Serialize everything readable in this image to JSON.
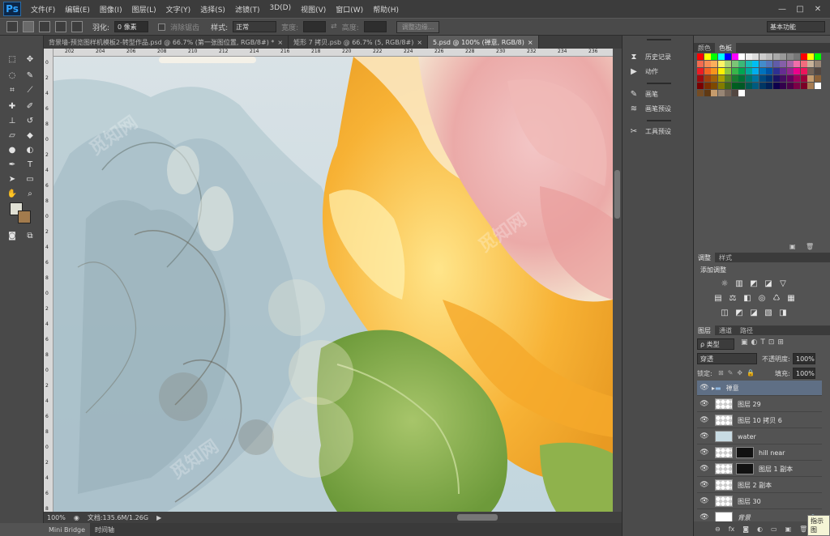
{
  "app": {
    "logo": "Ps"
  },
  "menu": [
    "文件(F)",
    "编辑(E)",
    "图像(I)",
    "图层(L)",
    "文字(Y)",
    "选择(S)",
    "滤镜(T)",
    "3D(D)",
    "视图(V)",
    "窗口(W)",
    "帮助(H)"
  ],
  "window_controls": {
    "minimize": "—",
    "restore": "□",
    "close": "✕"
  },
  "options_bar": {
    "feather_label": "羽化:",
    "feather_value": "0 像素",
    "antialias_label": "消除锯齿",
    "style_label": "样式:",
    "style_value": "正常",
    "width_label": "宽度:",
    "height_label": "高度:",
    "refine_button": "调整边缘...",
    "workspace": "基本功能"
  },
  "doc_tabs": [
    "背景墙-预览图样机模板2-转型作品.psd @ 66.7% (第一张图位置, RGB/8#) *",
    "矩形 7 拷贝.psb @ 66.7% (5, RGB/8#)",
    "5.psd @ 100% (禅意, RGB/8)"
  ],
  "ruler_top_labels": [
    "202",
    "204",
    "206",
    "208",
    "210",
    "212",
    "214",
    "216",
    "218",
    "220",
    "222",
    "224",
    "226",
    "228",
    "230",
    "232",
    "234",
    "236"
  ],
  "ruler_left_labels": [
    "0",
    "2",
    "4",
    "6",
    "8",
    "0",
    "2",
    "4",
    "6",
    "8",
    "0",
    "2",
    "4",
    "6",
    "8",
    "0",
    "2",
    "4",
    "6",
    "8",
    "0",
    "2",
    "4",
    "6",
    "8",
    "0",
    "2",
    "4",
    "6",
    "8"
  ],
  "status": {
    "zoom": "100%",
    "doc_info": "文档:135.6M/1.26G"
  },
  "bottom_tabs": [
    "Mini Bridge",
    "时间轴"
  ],
  "mid_panel": {
    "items": [
      {
        "label": "历史记录",
        "icon": "history-icon"
      },
      {
        "label": "动作",
        "icon": "play-icon"
      },
      {
        "label": "画笔",
        "icon": "brush-icon"
      },
      {
        "label": "画笔预设",
        "icon": "brush-preset-icon"
      },
      {
        "label": "工具预设",
        "icon": "tool-preset-icon"
      }
    ]
  },
  "swatch_panel": {
    "tabs": [
      "颜色",
      "色板"
    ]
  },
  "adjust_panel": {
    "tabs": [
      "调整",
      "样式"
    ],
    "title": "添加调整"
  },
  "layers_panel": {
    "tabs": [
      "图层",
      "通道",
      "路径"
    ],
    "filter_kind": "ρ 类型",
    "blend_mode": "穿透",
    "opacity_label": "不透明度:",
    "opacity_value": "100%",
    "lock_label": "锁定:",
    "fill_label": "填充:",
    "fill_value": "100%",
    "layers": [
      {
        "name": "禅意",
        "type": "group"
      },
      {
        "name": "图层 29",
        "type": "layer"
      },
      {
        "name": "图层 10 拷贝 6",
        "type": "layer"
      },
      {
        "name": "water",
        "type": "layer"
      },
      {
        "name": "hill near",
        "type": "mask"
      },
      {
        "name": "图层 1 副本",
        "type": "mask"
      },
      {
        "name": "图层 2 副本",
        "type": "layer"
      },
      {
        "name": "图层 30",
        "type": "layer"
      },
      {
        "name": "背景",
        "type": "background"
      }
    ],
    "tooltip": "指示图"
  },
  "watermark_text": "觅知网",
  "colors": {
    "accent": "#2fa3ff",
    "selected_layer": "#5f6f85"
  }
}
